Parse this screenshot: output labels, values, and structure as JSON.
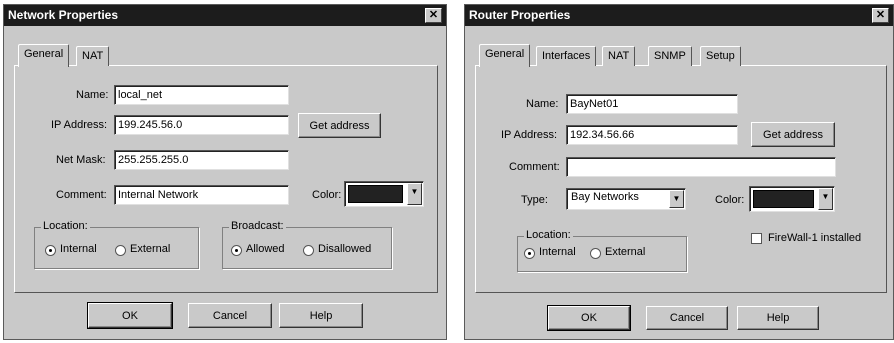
{
  "network_dialog": {
    "title": "Network Properties",
    "close_glyph": "✕",
    "tabs": [
      {
        "label": "General",
        "active": true
      },
      {
        "label": "NAT",
        "active": false
      }
    ],
    "name": {
      "label": "Name:",
      "value": "local_net"
    },
    "ip_address": {
      "label": "IP Address:",
      "value": "199.245.56.0"
    },
    "get_address_label": "Get address",
    "net_mask": {
      "label": "Net Mask:",
      "value": "255.255.255.0"
    },
    "comment": {
      "label": "Comment:",
      "value": "Internal Network"
    },
    "color": {
      "label": "Color:",
      "swatch": "#222222"
    },
    "location": {
      "title": "Location:",
      "internal": "Internal",
      "external": "External",
      "selected": "Internal"
    },
    "broadcast": {
      "title": "Broadcast:",
      "allowed": "Allowed",
      "disallowed": "Disallowed",
      "selected": "Allowed"
    },
    "buttons": {
      "ok": "OK",
      "cancel": "Cancel",
      "help": "Help"
    }
  },
  "router_dialog": {
    "title": "Router Properties",
    "close_glyph": "✕",
    "tabs": [
      {
        "label": "General",
        "active": true
      },
      {
        "label": "Interfaces",
        "active": false
      },
      {
        "label": "NAT",
        "active": false
      },
      {
        "label": "SNMP",
        "active": false
      },
      {
        "label": "Setup",
        "active": false
      }
    ],
    "name": {
      "label": "Name:",
      "value": "BayNet01"
    },
    "ip_address": {
      "label": "IP Address:",
      "value": "192.34.56.66"
    },
    "get_address_label": "Get address",
    "comment": {
      "label": "Comment:",
      "value": ""
    },
    "type": {
      "label": "Type:",
      "value": "Bay Networks"
    },
    "color": {
      "label": "Color:",
      "swatch": "#222222"
    },
    "location": {
      "title": "Location:",
      "internal": "Internal",
      "external": "External",
      "selected": "Internal"
    },
    "firewall": {
      "label": "FireWall-1 installed",
      "checked": false
    },
    "buttons": {
      "ok": "OK",
      "cancel": "Cancel",
      "help": "Help"
    }
  },
  "icons": {
    "dropdown_arrow": "▼"
  }
}
